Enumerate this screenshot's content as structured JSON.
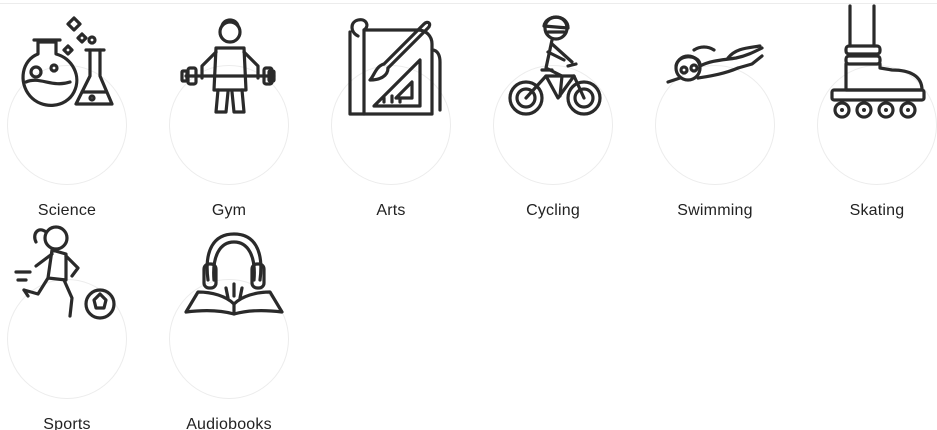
{
  "categories": [
    {
      "label": "Science",
      "icon": "science-flasks-icon"
    },
    {
      "label": "Gym",
      "icon": "gym-weightlifter-icon"
    },
    {
      "label": "Arts",
      "icon": "arts-brush-ruler-icon"
    },
    {
      "label": "Cycling",
      "icon": "cycling-rider-icon"
    },
    {
      "label": "Swimming",
      "icon": "swimming-swimmer-icon"
    },
    {
      "label": "Skating",
      "icon": "skating-rollerblade-icon"
    },
    {
      "label": "Sports",
      "icon": "sports-soccer-player-icon"
    },
    {
      "label": "Audiobooks",
      "icon": "audiobooks-headphones-book-icon"
    }
  ],
  "colors": {
    "stroke": "#2a2a2a",
    "circle_border": "#ececec",
    "text": "#222222"
  }
}
